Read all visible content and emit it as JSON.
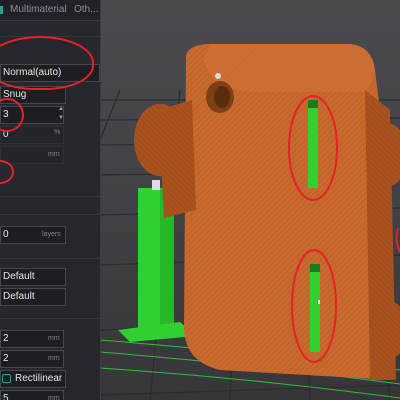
{
  "tabs": [
    {
      "label": "Multimaterial"
    },
    {
      "label": "Oth..."
    }
  ],
  "settings": {
    "seam_position": "Normal(auto)",
    "seam_value": "Snug",
    "wall_loops": "3",
    "pct_value": "0",
    "pct_unit": "%",
    "mm_unit_1": "mm",
    "layers_value": "0",
    "layers_unit": "layers",
    "default_1": "Default",
    "default_2": "Default",
    "val_2a": "2",
    "unit_2a": "mm",
    "val_2b": "2",
    "unit_2b": "mm",
    "pattern": "Rectilinear",
    "val_5": "5",
    "unit_5": "mm"
  },
  "colors": {
    "part_orange": "#c8692e",
    "support_green": "#2fd12f",
    "annotation_red": "#e8202a",
    "accent_teal": "#1ea39a"
  }
}
